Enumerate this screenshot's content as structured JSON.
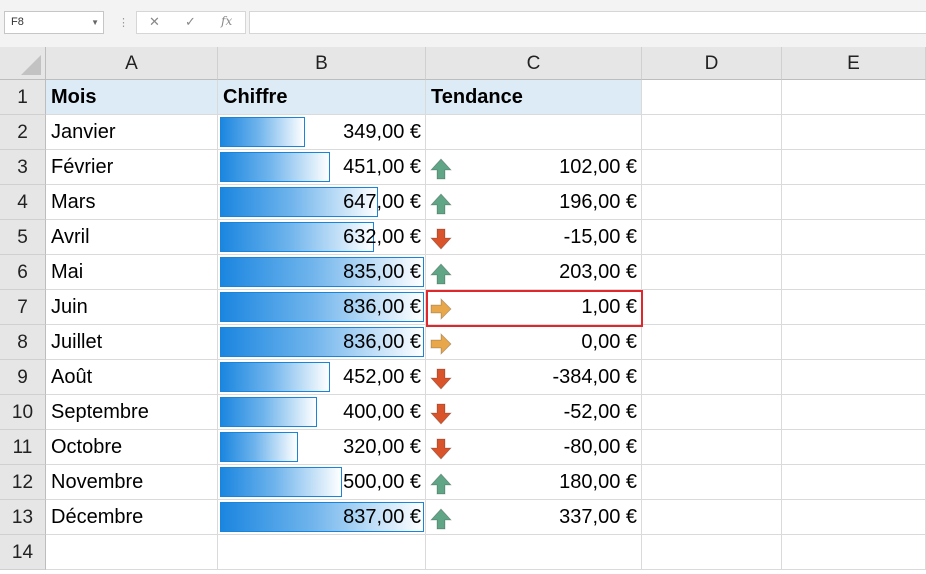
{
  "name_box": "F8",
  "formula_icons": [
    "close-icon",
    "check-icon",
    "fx-icon"
  ],
  "columns": [
    "A",
    "B",
    "C",
    "D",
    "E"
  ],
  "rows": [
    "1",
    "2",
    "3",
    "4",
    "5",
    "6",
    "7",
    "8",
    "9",
    "10",
    "11",
    "12",
    "13",
    "14"
  ],
  "headers": {
    "a": "Mois",
    "b": "Chiffre",
    "c": "Tendance"
  },
  "data": [
    {
      "mois": "Janvier",
      "chiffre": "349,00 €",
      "value": 349,
      "trend": "",
      "icon": ""
    },
    {
      "mois": "Février",
      "chiffre": "451,00 €",
      "value": 451,
      "trend": "102,00 €",
      "icon": "up"
    },
    {
      "mois": "Mars",
      "chiffre": "647,00 €",
      "value": 647,
      "trend": "196,00 €",
      "icon": "up"
    },
    {
      "mois": "Avril",
      "chiffre": "632,00 €",
      "value": 632,
      "trend": "-15,00 €",
      "icon": "down"
    },
    {
      "mois": "Mai",
      "chiffre": "835,00 €",
      "value": 835,
      "trend": "203,00 €",
      "icon": "up"
    },
    {
      "mois": "Juin",
      "chiffre": "836,00 €",
      "value": 836,
      "trend": "1,00 €",
      "icon": "right"
    },
    {
      "mois": "Juillet",
      "chiffre": "836,00 €",
      "value": 836,
      "trend": "0,00 €",
      "icon": "right"
    },
    {
      "mois": "Août",
      "chiffre": "452,00 €",
      "value": 452,
      "trend": "-384,00 €",
      "icon": "down"
    },
    {
      "mois": "Septembre",
      "chiffre": "400,00 €",
      "value": 400,
      "trend": "-52,00 €",
      "icon": "down"
    },
    {
      "mois": "Octobre",
      "chiffre": "320,00 €",
      "value": 320,
      "trend": "-80,00 €",
      "icon": "down"
    },
    {
      "mois": "Novembre",
      "chiffre": "500,00 €",
      "value": 500,
      "trend": "180,00 €",
      "icon": "up"
    },
    {
      "mois": "Décembre",
      "chiffre": "837,00 €",
      "value": 837,
      "trend": "337,00 €",
      "icon": "up"
    }
  ],
  "databar_range": [
    0,
    837
  ],
  "colors": {
    "databar": "#1b86e0",
    "up": "#5fa586",
    "down": "#d9542b",
    "flat": "#e8a74a",
    "header_fill": "#ddebf7",
    "selection": "#e0282c"
  }
}
